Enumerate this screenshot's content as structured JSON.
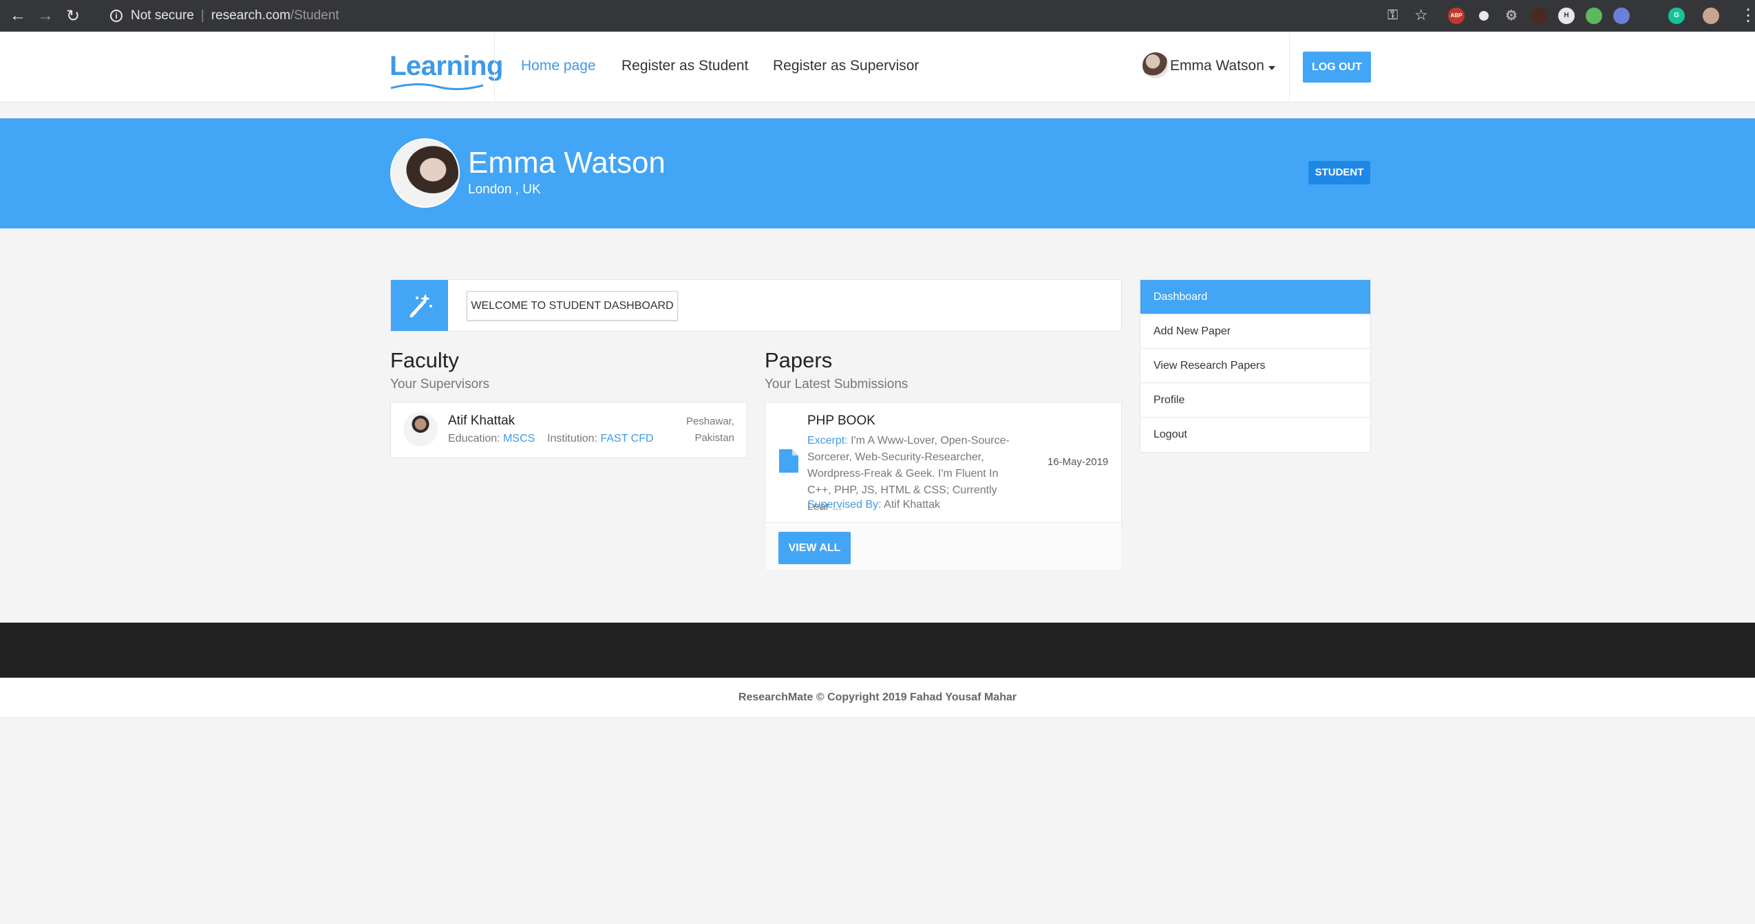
{
  "browser": {
    "security_label": "Not secure",
    "url_host": "research.com",
    "url_path": "/Student",
    "ext_abp": "ABP",
    "ext_h": "H",
    "ext_g": "G"
  },
  "nav": {
    "logo": "Learning",
    "links": [
      "Home page",
      "Register as Student",
      "Register as Supervisor"
    ],
    "user_name": "Emma Watson",
    "logout_label": "LOG OUT"
  },
  "profile": {
    "name": "Emma Watson",
    "location": "London , UK",
    "role_badge": "STUDENT"
  },
  "welcome": {
    "label": "WELCOME TO STUDENT DASHBOARD"
  },
  "faculty": {
    "title": "Faculty",
    "subtitle": "Your Supervisors",
    "supervisor": {
      "name": "Atif Khattak",
      "education_label": "Education:",
      "education": "MSCS",
      "institution_label": "Institution:",
      "institution": "FAST CFD",
      "city": "Peshawar,",
      "country": "Pakistan"
    }
  },
  "papers": {
    "title": "Papers",
    "subtitle": "Your Latest Submissions",
    "latest": {
      "title": "PHP BOOK",
      "excerpt_label": "Excerpt:",
      "excerpt": "I'm A Www-Lover, Open-Source-Sorcerer, Web-Security-Researcher, Wordpress-Freak & Geek. I'm Fluent In C++, PHP, JS, HTML & CSS; Currently Lear ...",
      "supervised_label": "Supervised By:",
      "supervisor": "Atif Khattak",
      "date": "16-May-2019"
    },
    "view_all_label": "VIEW ALL"
  },
  "sidebar": {
    "items": [
      {
        "label": "Dashboard"
      },
      {
        "label": "Add New Paper"
      },
      {
        "label": "View Research Papers"
      },
      {
        "label": "Profile"
      },
      {
        "label": "Logout"
      }
    ]
  },
  "footer": {
    "copyright": "ResearchMate © Copyright 2019 Fahad Yousaf Mahar"
  },
  "colors": {
    "accent": "#42a5f5",
    "link": "#3d9ae8",
    "footer_dark": "#212121"
  }
}
